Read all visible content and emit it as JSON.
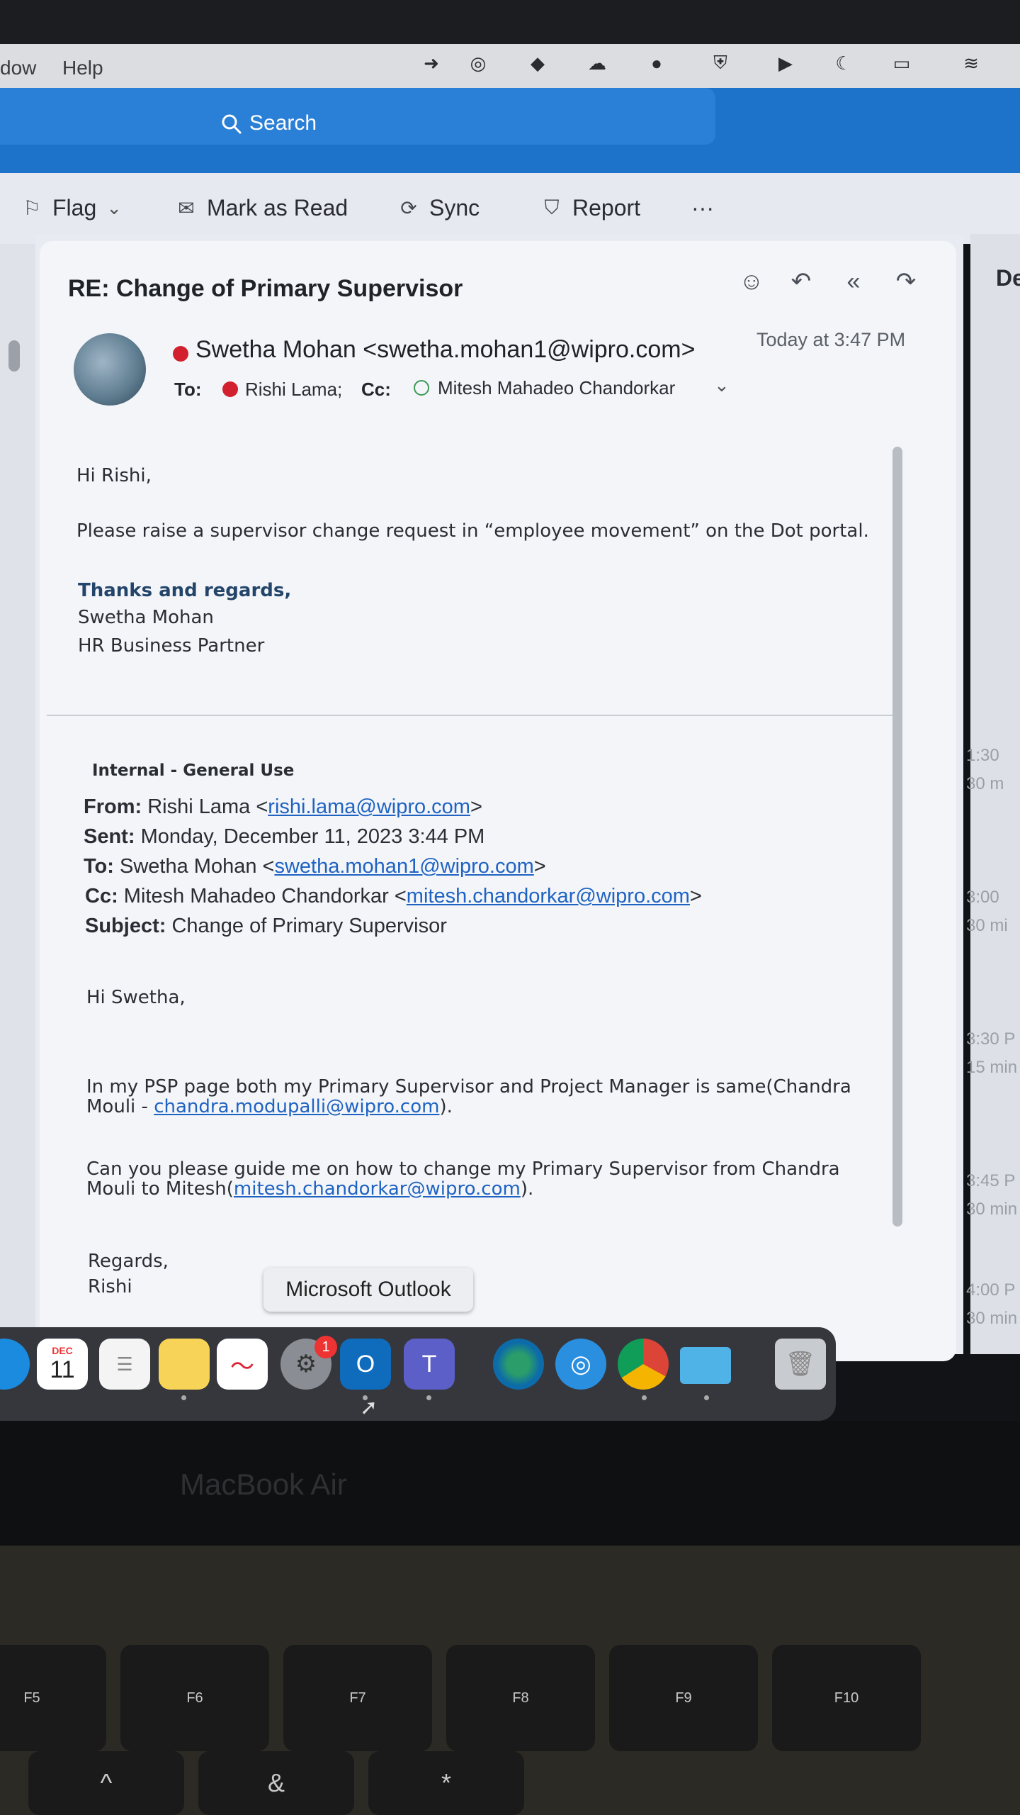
{
  "menubar": {
    "items": [
      "dow",
      "Help"
    ]
  },
  "search": {
    "label": "Search"
  },
  "toolbar": {
    "flag": "Flag",
    "mark_as_read": "Mark as Read",
    "sync": "Sync",
    "report": "Report",
    "more": "···"
  },
  "right_column": {
    "header": "De",
    "times": [
      "1:30",
      "30 m",
      "3:00",
      "30 mi",
      "3:30 P",
      "15 min",
      "3:45 P",
      "30 min",
      "4:00 P",
      "30 min"
    ]
  },
  "message": {
    "subject": "RE: Change of Primary Supervisor",
    "sender": "Swetha Mohan <swetha.mohan1@wipro.com>",
    "timestamp": "Today at 3:47 PM",
    "to_label": "To:",
    "to_name": "Rishi Lama;",
    "cc_label": "Cc:",
    "cc_name": "Mitesh Mahadeo Chandorkar",
    "body": {
      "greeting": "Hi Rishi,",
      "line1": "Please raise a supervisor change request in “employee movement” on the Dot portal.",
      "closing": "Thanks and regards,",
      "sig_name": "Swetha Mohan",
      "sig_title": "HR Business Partner"
    },
    "quoted": {
      "classification": "Internal - General Use",
      "from_label": "From:",
      "from_name": "Rishi Lama <",
      "from_email": "rishi.lama@wipro.com",
      "sent_label": "Sent:",
      "sent_value": "Monday, December 11, 2023 3:44 PM",
      "to_label": "To:",
      "to_name": "Swetha Mohan <",
      "to_email": "swetha.mohan1@wipro.com",
      "cc_label": "Cc:",
      "cc_name": "Mitesh Mahadeo Chandorkar <",
      "cc_email": "mitesh.chandorkar@wipro.com",
      "subject_label": "Subject:",
      "subject_value": "Change of Primary Supervisor",
      "greeting": "Hi Swetha,",
      "para1_a": "In my PSP page both my Primary Supervisor and Project Manager is same(Chandra",
      "para1_b": "Mouli - ",
      "para1_email": "chandra.modupalli@wipro.com",
      "para1_c": ").",
      "para2_a": "Can you please guide me on how to change my Primary Supervisor from Chandra",
      "para2_b": "Mouli to Mitesh(",
      "para2_email": "mitesh.chandorkar@wipro.com",
      "para2_c": ").",
      "regards": "Regards,",
      "name": "Rishi"
    }
  },
  "tooltip": "Microsoft Outlook",
  "dock": {
    "calendar_month": "DEC",
    "calendar_day": "11",
    "settings_badge": "1",
    "outlook_letter": "O",
    "teams_letter": "T"
  },
  "device_label": "MacBook Air",
  "keys": [
    "F5",
    "F6",
    "F7",
    "F8",
    "F9",
    "F10"
  ],
  "keys_row2": [
    "^",
    "&",
    "*"
  ]
}
